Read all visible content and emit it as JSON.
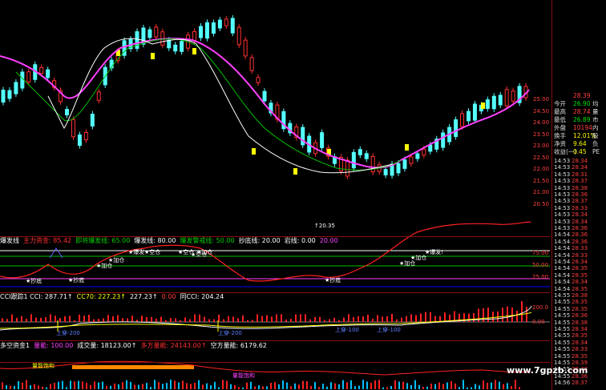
{
  "price_panel": {
    "low_marker": "20.35",
    "axis_ticks": [
      "25.00",
      "24.50",
      "24.00",
      "23.50",
      "23.00",
      "22.50",
      "22.00",
      "21.50",
      "21.00",
      "20.50"
    ]
  },
  "panel2": {
    "items": [
      {
        "text": "爆发线",
        "color": "#ffffff"
      },
      {
        "text": "主力资金: 85.42",
        "color": "#ff3030"
      },
      {
        "text": "即将爆发线: 65.00",
        "color": "#00d000"
      },
      {
        "text": "爆发线: 80.00",
        "color": "#ffffff"
      },
      {
        "text": "爆发警戒线: 50.00",
        "color": "#00d000"
      },
      {
        "text": "抄底线: 20.00",
        "color": "#ffffff"
      },
      {
        "text": "岩线: 0.00",
        "color": "#ffffff"
      },
      {
        "text": "20.00",
        "color": "#ff40ff"
      }
    ],
    "axis_ticks": [
      "75.00",
      "50.00",
      "25.00"
    ],
    "labels": [
      "★抄底",
      "★抄底",
      "★加仓",
      "★加仓",
      "★空仓",
      "★空仓",
      "★爆发",
      "★加仓",
      "★空仓",
      "★抄底",
      "★加仓",
      "★加仓",
      "★爆发!"
    ]
  },
  "panel3": {
    "items": [
      {
        "text": "CCI跟踪1 CCI: 287.71↑",
        "color": "#ffffff"
      },
      {
        "text": "CC70: 227.23↑",
        "color": "#ffff00"
      },
      {
        "text": "227.23↑",
        "color": "#ffffff"
      },
      {
        "text": "0.00",
        "color": "#ff4040"
      },
      {
        "text": "同CCI: 204.24",
        "color": "#ffffff"
      }
    ],
    "axis_ticks": [
      "200.0",
      "0.00"
    ],
    "labels": [
      "上穿-200",
      "上穿-200",
      "上穿-100",
      "上穿-100"
    ]
  },
  "panel4": {
    "items": [
      {
        "text": "多空资金1",
        "color": "#ffffff"
      },
      {
        "text": "量能: 100.00",
        "color": "#ff40ff"
      },
      {
        "text": "成交量: 18123.00↑",
        "color": "#ffffff"
      },
      {
        "text": "多方量能: 24143.00↑",
        "color": "#ff3030"
      },
      {
        "text": "空方量能: 6179.62",
        "color": "#ffffff"
      }
    ],
    "labels": [
      "量能饱和",
      "量能饱和"
    ]
  },
  "quote": {
    "rows": [
      {
        "k": "",
        "v": "28.39",
        "x": "",
        "color": "#ff4040"
      },
      {
        "k": "今开",
        "v": "26.90",
        "x": "均",
        "color": "#00e000"
      },
      {
        "k": "最高",
        "v": "28.74",
        "x": "量",
        "color": "#ff4040"
      },
      {
        "k": "最低",
        "v": "26.89",
        "x": "市",
        "color": "#00e000"
      },
      {
        "k": "外盘",
        "v": "10194",
        "x": "内",
        "color": "#ff4040"
      },
      {
        "k": "换手",
        "v": "12.01%",
        "x": "股",
        "color": "#ffff00"
      },
      {
        "k": "净资",
        "v": "9.64",
        "x": "负",
        "color": "#ffff00"
      },
      {
        "k": "收益(一)",
        "v": "0.45",
        "x": "PE",
        "color": "#ffff00"
      }
    ]
  },
  "ticks": {
    "rows": [
      {
        "t": "14:53",
        "p": "28.34"
      },
      {
        "t": "14:53",
        "p": "28.34"
      },
      {
        "t": "14:53",
        "p": "28.31"
      },
      {
        "t": "14:53",
        "p": "28.37"
      },
      {
        "t": "14:53",
        "p": "28.38"
      },
      {
        "t": "14:53",
        "p": "28.36"
      },
      {
        "t": "14:53",
        "p": "28.37"
      },
      {
        "t": "14:53",
        "p": "28.33"
      },
      {
        "t": "14:53",
        "p": "28.34"
      },
      {
        "t": "14:53",
        "p": "28.34"
      },
      {
        "t": "14:53",
        "p": "28.36"
      },
      {
        "t": "14:54",
        "p": "28.36"
      },
      {
        "t": "14:54",
        "p": "28.36"
      },
      {
        "t": "14:54",
        "p": "28.33"
      },
      {
        "t": "14:54",
        "p": "28.33"
      },
      {
        "t": "14:54",
        "p": "28.34"
      },
      {
        "t": "14:54",
        "p": "28.35"
      },
      {
        "t": "14:54",
        "p": "28.35"
      },
      {
        "t": "14:54",
        "p": "28.34"
      },
      {
        "t": "14:54",
        "p": "28.35"
      },
      {
        "t": "14:55",
        "p": "28.38"
      },
      {
        "t": "14:55",
        "p": "28.35"
      },
      {
        "t": "14:55",
        "p": "28.35"
      },
      {
        "t": "14:55",
        "p": "28.36"
      },
      {
        "t": "14:55",
        "p": "28.38"
      },
      {
        "t": "14:55",
        "p": "28.34"
      },
      {
        "t": "14:55",
        "p": "28.35"
      },
      {
        "t": "14:55",
        "p": "28.34"
      },
      {
        "t": "14:55",
        "p": "28.33"
      },
      {
        "t": "14:55",
        "p": "28.35"
      },
      {
        "t": "14:55",
        "p": "28.39"
      },
      {
        "t": "14:55",
        "p": "28.38"
      },
      {
        "t": "14:55",
        "p": "28.36"
      },
      {
        "t": "14:56",
        "p": "28.37"
      }
    ]
  },
  "watermark": "www.7gpzb.com",
  "colors": {
    "up": "#ff3030",
    "down": "#54ffff",
    "ma_fast": "#ffffff",
    "ma_mid": "#ffff00",
    "ma_slow": "#ff40ff",
    "grid": "#8a1010"
  }
}
